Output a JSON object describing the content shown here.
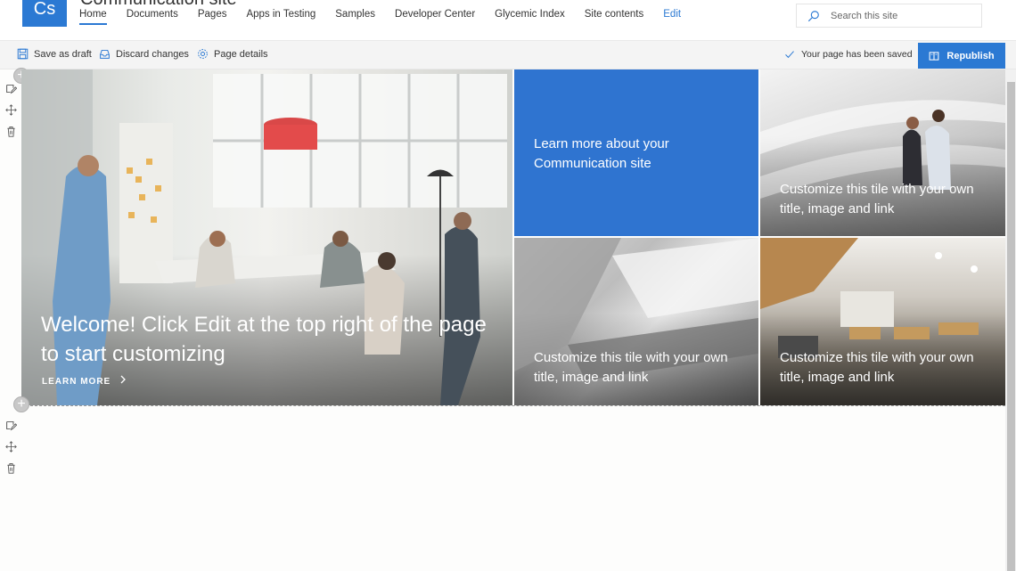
{
  "header": {
    "logo_text": "Cs",
    "site_title": "Communication site",
    "nav": [
      {
        "label": "Home"
      },
      {
        "label": "Documents"
      },
      {
        "label": "Pages"
      },
      {
        "label": "Apps in Testing"
      },
      {
        "label": "Samples"
      },
      {
        "label": "Developer Center"
      },
      {
        "label": "Glycemic Index"
      },
      {
        "label": "Site contents"
      },
      {
        "label": "Edit"
      }
    ],
    "search_placeholder": "Search this site"
  },
  "command_bar": {
    "save_draft": "Save as draft",
    "discard": "Discard changes",
    "page_details": "Page details",
    "status": "Your page has been saved",
    "republish": "Republish"
  },
  "hero": {
    "main_title": "Welcome! Click Edit at the top right of the page to start customizing",
    "learn_more": "LEARN MORE",
    "blue_tile": "Learn more about your Communication site",
    "tile_a": "Customize this tile with your own title, image and link",
    "tile_b": "Customize this tile with your own title, image and link",
    "tile_c": "Customize this tile with your own title, image and link"
  },
  "colors": {
    "accent": "#2b79d3",
    "blue_tile": "#2f74d0",
    "command_bar": "#f4f4f4"
  },
  "icons": [
    "search-icon",
    "save-icon",
    "discard-icon",
    "gear-icon",
    "check-icon",
    "republish-icon",
    "add-section-icon",
    "edit-section-icon",
    "move-section-icon",
    "delete-section-icon",
    "chevron-right-icon"
  ]
}
